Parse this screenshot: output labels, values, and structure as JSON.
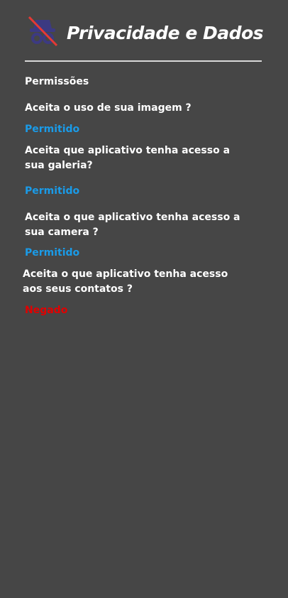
{
  "header": {
    "title": "Privacidade e Dados",
    "logo_icon": "incognito-icon",
    "logo_strike_color": "#e53935",
    "logo_color": "#3f3f8a"
  },
  "section": {
    "title": "Permissões"
  },
  "permissions": [
    {
      "question": "Aceita o uso de sua imagem ?",
      "status": "Permitido"
    },
    {
      "question": "Aceita que aplicativo tenha acesso a sua galeria?",
      "status": "Permitido"
    },
    {
      "question": "Aceita o que aplicativo tenha acesso a sua camera ?",
      "status": "Permitido"
    },
    {
      "question": "Aceita o que aplicativo tenha acesso aos seus contatos ?",
      "status": "Negado"
    }
  ],
  "colors": {
    "background": "#464646",
    "allowed": "#1a9be8",
    "denied": "#e10000"
  }
}
